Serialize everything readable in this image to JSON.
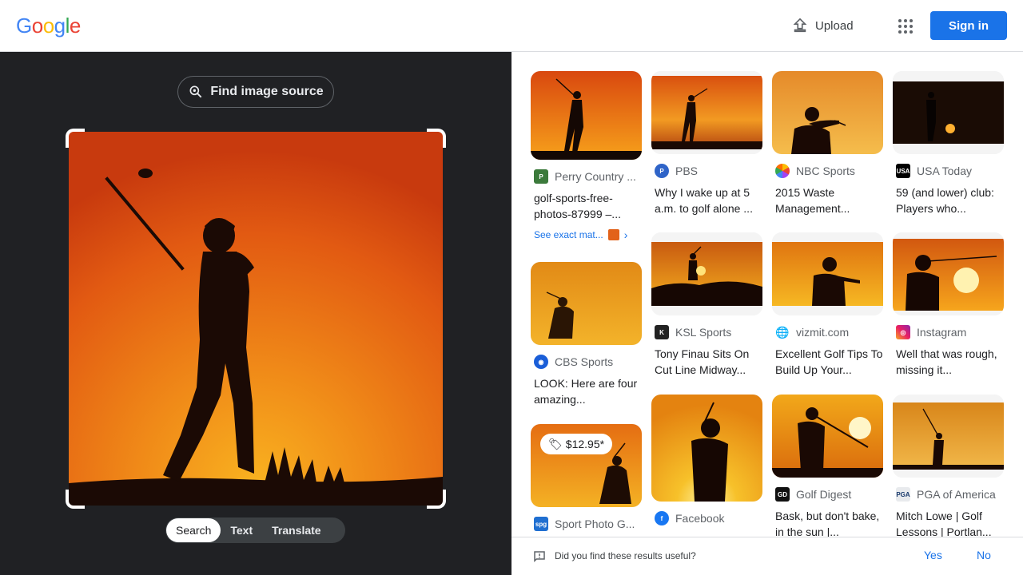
{
  "header": {
    "logo_letters": [
      "G",
      "o",
      "o",
      "g",
      "l",
      "e"
    ],
    "logo_colors": [
      "#4285F4",
      "#EA4335",
      "#FBBC05",
      "#4285F4",
      "#34A853",
      "#EA4335"
    ],
    "upload_label": "Upload",
    "signin_label": "Sign in"
  },
  "left": {
    "find_source_label": "Find image source",
    "tabs": [
      "Search",
      "Text",
      "Translate"
    ],
    "active_tab": "Search"
  },
  "results": [
    {
      "source": "Perry Country ...",
      "title": "golf-sports-free-photos-87999 –...",
      "favicon": "perry-favicon",
      "exact_label": "See exact mat..."
    },
    {
      "source": "PBS",
      "title": "Why I wake up at 5 a.m. to golf alone ...",
      "favicon": "pbs-favicon"
    },
    {
      "source": "NBC Sports",
      "title": "2015 Waste Management...",
      "favicon": "nbc-favicon"
    },
    {
      "source": "USA Today",
      "title": "59 (and lower) club: Players who...",
      "favicon": "usatoday-favicon"
    },
    {
      "source": "CBS Sports",
      "title": "LOOK: Here are four amazing...",
      "favicon": "cbs-favicon"
    },
    {
      "source": "KSL Sports",
      "title": "Tony Finau Sits On Cut Line Midway...",
      "favicon": "ksl-favicon"
    },
    {
      "source": "vizmit.com",
      "title": "Excellent Golf Tips To Build Up Your...",
      "favicon": "globe-icon"
    },
    {
      "source": "Instagram",
      "title": "Well that was rough, missing it...",
      "favicon": "instagram-favicon"
    },
    {
      "source": "Sport Photo G...",
      "title": "",
      "favicon": "spg-favicon",
      "price": "$12.95*"
    },
    {
      "source": "Facebook",
      "title": "",
      "favicon": "facebook-favicon"
    },
    {
      "source": "Golf Digest",
      "title": "Bask, but don't bake, in the sun |...",
      "favicon": "golfdigest-favicon"
    },
    {
      "source": "PGA of America",
      "title": "Mitch Lowe | Golf Lessons | Portlan...",
      "favicon": "pga-favicon"
    }
  ],
  "feedback": {
    "question": "Did you find these results useful?",
    "yes_label": "Yes",
    "no_label": "No"
  },
  "colors": {
    "accent": "#1a73e8",
    "dark_panel": "#202124",
    "sunset_orange": "#e8610f"
  }
}
